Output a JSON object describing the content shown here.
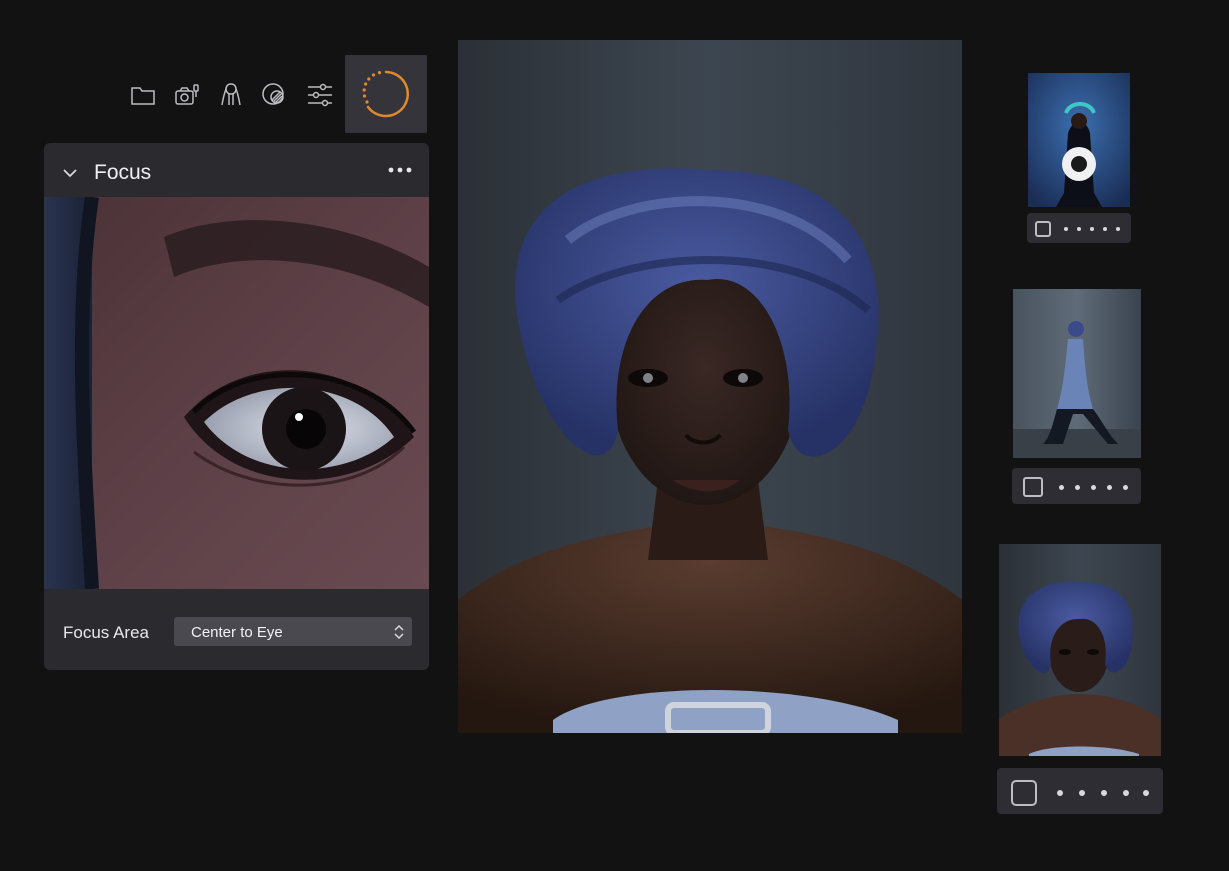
{
  "toolbar": {
    "icons": [
      "folder-icon",
      "camera-icon",
      "portrait-icon",
      "color-wheel-icon",
      "sliders-icon",
      "focus-ring-icon"
    ],
    "accent": "#e08a2e"
  },
  "focus_panel": {
    "title": "Focus",
    "focus_area_label": "Focus Area",
    "focus_area_value": "Center to Eye"
  },
  "thumbnails": [
    {
      "name": "thumb-1",
      "rating_dots": 5
    },
    {
      "name": "thumb-2",
      "rating_dots": 5
    },
    {
      "name": "thumb-3",
      "rating_dots": 5
    }
  ]
}
